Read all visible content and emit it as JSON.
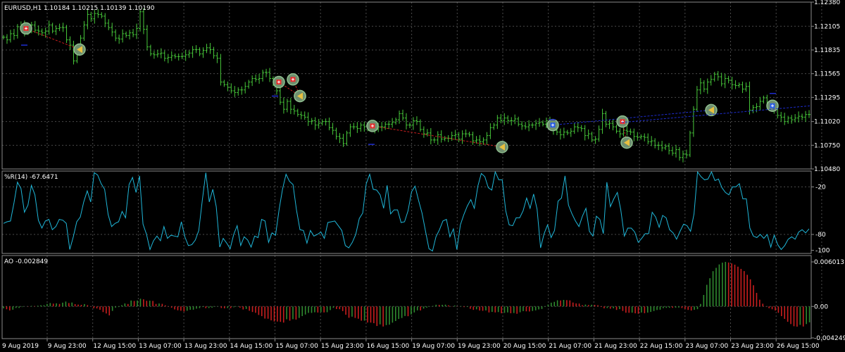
{
  "main_panel": {
    "title": "EURUSD,H1  1.10184 1.10215 1.10139 1.10190",
    "y_ticks": [
      "1.12380",
      "1.12105",
      "1.11835",
      "1.11565",
      "1.11295",
      "1.11020",
      "1.10750",
      "1.10480"
    ]
  },
  "wpr_panel": {
    "title": "%R(14) -67.6471",
    "y_ticks": [
      "-20",
      "-80",
      "-100"
    ]
  },
  "ao_panel": {
    "title": "AO -0.002849",
    "y_ticks": [
      "0.006013",
      "0.00",
      "-0.004249"
    ]
  },
  "x_ticks": [
    "9 Aug 2019",
    "9 Aug 23:00",
    "12 Aug 15:00",
    "13 Aug 07:00",
    "13 Aug 23:00",
    "14 Aug 15:00",
    "15 Aug 07:00",
    "15 Aug 23:00",
    "16 Aug 15:00",
    "19 Aug 07:00",
    "19 Aug 23:00",
    "20 Aug 15:00",
    "21 Aug 07:00",
    "21 Aug 23:00",
    "22 Aug 15:00",
    "23 Aug 07:00",
    "23 Aug 23:00",
    "26 Aug 15:00"
  ],
  "colors": {
    "background": "#000000",
    "grid": "#4a4a4a",
    "text": "#ffffff",
    "bar": "#47c83a",
    "wpr_line": "#1fb6d8",
    "ao_up": "#2f8a2f",
    "ao_down": "#c81e1e",
    "signal_line": "#1e2ccf",
    "trade_line": "#c81e1e",
    "marker_ring": "#8fbf8f"
  },
  "chart_data": [
    {
      "type": "ohlc",
      "name": "EURUSD,H1",
      "ylim": [
        1.1048,
        1.1238
      ],
      "close": [
        1.1198,
        1.1195,
        1.1202,
        1.12,
        1.121,
        1.1212,
        1.1203,
        1.1207,
        1.1212,
        1.1206,
        1.1205,
        1.1203,
        1.1205,
        1.1212,
        1.1205,
        1.1208,
        1.1209,
        1.1209,
        1.1195,
        1.1189,
        1.1171,
        1.1186,
        1.1197,
        1.1212,
        1.1224,
        1.1219,
        1.1225,
        1.1224,
        1.1222,
        1.1214,
        1.1209,
        1.1204,
        1.1197,
        1.1196,
        1.1202,
        1.12,
        1.1203,
        1.1201,
        1.1208,
        1.1227,
        1.1207,
        1.1187,
        1.1179,
        1.1178,
        1.1179,
        1.118,
        1.1174,
        1.1175,
        1.1177,
        1.1176,
        1.1176,
        1.1176,
        1.1178,
        1.118,
        1.1184,
        1.1184,
        1.1179,
        1.1183,
        1.1186,
        1.1184,
        1.1177,
        1.1174,
        1.1147,
        1.1144,
        1.1141,
        1.1137,
        1.1135,
        1.1138,
        1.1138,
        1.1142,
        1.1147,
        1.1151,
        1.115,
        1.1151,
        1.1158,
        1.1158,
        1.1151,
        1.1145,
        1.1137,
        1.1124,
        1.1116,
        1.1125,
        1.1116,
        1.1114,
        1.111,
        1.1109,
        1.1107,
        1.1102,
        1.1103,
        1.1098,
        1.11,
        1.1102,
        1.1102,
        1.1095,
        1.1092,
        1.1085,
        1.1083,
        1.1077,
        1.1089,
        1.1096,
        1.1096,
        1.1094,
        1.1098,
        1.1096,
        1.1095,
        1.1096,
        1.1093,
        1.1096,
        1.1096,
        1.1099,
        1.1099,
        1.1101,
        1.1104,
        1.1111,
        1.1106,
        1.1098,
        1.1098,
        1.1103,
        1.1102,
        1.1093,
        1.1088,
        1.1089,
        1.1081,
        1.1081,
        1.1087,
        1.1082,
        1.1083,
        1.1083,
        1.1086,
        1.1087,
        1.1082,
        1.1088,
        1.1088,
        1.1087,
        1.108,
        1.1081,
        1.1079,
        1.1081,
        1.1086,
        1.1095,
        1.1098,
        1.1106,
        1.1103,
        1.1106,
        1.1103,
        1.1103,
        1.1105,
        1.1099,
        1.1097,
        1.1096,
        1.1098,
        1.1098,
        1.11,
        1.1101,
        1.1099,
        1.1103,
        1.1099,
        1.1092,
        1.109,
        1.1087,
        1.109,
        1.1089,
        1.1091,
        1.1096,
        1.1095,
        1.1094,
        1.1086,
        1.1088,
        1.1081,
        1.1082,
        1.1093,
        1.1111,
        1.1099,
        1.11,
        1.1096,
        1.1091,
        1.1088,
        1.1092,
        1.1091,
        1.109,
        1.1085,
        1.1084,
        1.1085,
        1.1084,
        1.1079,
        1.108,
        1.1075,
        1.1075,
        1.1072,
        1.1074,
        1.1069,
        1.1066,
        1.107,
        1.1061,
        1.1065,
        1.1064,
        1.1089,
        1.1116,
        1.1138,
        1.1146,
        1.1139,
        1.1147,
        1.115,
        1.1156,
        1.1153,
        1.1145,
        1.1151,
        1.1149,
        1.1144,
        1.1143,
        1.1144,
        1.1139,
        1.1142,
        1.1115,
        1.1118,
        1.1119,
        1.1125,
        1.1129,
        1.1121,
        1.112,
        1.1116,
        1.1109,
        1.1107,
        1.1102,
        1.1106,
        1.1104,
        1.1106,
        1.1108,
        1.1107,
        1.111,
        1.111
      ]
    },
    {
      "type": "line",
      "name": "%R(14)",
      "ylim": [
        -104,
        0
      ],
      "values": [
        -66,
        -64,
        -63,
        -40,
        -14,
        -22,
        -52,
        -43,
        -18,
        -30,
        -62,
        -72,
        -63,
        -61,
        -74,
        -70,
        -61,
        -62,
        -66,
        -99,
        -83,
        -64,
        -58,
        -39,
        -25,
        -39,
        -2,
        -5,
        -16,
        -23,
        -55,
        -70,
        -66,
        -64,
        -51,
        -59,
        -17,
        -8,
        -27,
        -6,
        -67,
        -80,
        -99,
        -88,
        -82,
        -88,
        -70,
        -85,
        -81,
        -82,
        -83,
        -64,
        -83,
        -94,
        -93,
        -87,
        -75,
        -37,
        -2,
        -39,
        -23,
        -45,
        -96,
        -85,
        -91,
        -98,
        -80,
        -69,
        -94,
        -83,
        -87,
        -96,
        -82,
        -84,
        -61,
        -63,
        -90,
        -78,
        -81,
        -49,
        -23,
        -4,
        -13,
        -17,
        -49,
        -74,
        -75,
        -91,
        -75,
        -82,
        -80,
        -77,
        -85,
        -65,
        -64,
        -63,
        -69,
        -75,
        -94,
        -97,
        -90,
        -80,
        -60,
        -53,
        -16,
        -4,
        -23,
        -24,
        -30,
        -47,
        -18,
        -54,
        -49,
        -49,
        -65,
        -64,
        -50,
        -26,
        -19,
        -37,
        -53,
        -76,
        -98,
        -101,
        -83,
        -74,
        -63,
        -61,
        -83,
        -73,
        -99,
        -68,
        -55,
        -44,
        -36,
        -47,
        -19,
        -3,
        -7,
        -21,
        -24,
        -1,
        -11,
        -11,
        -50,
        -68,
        -69,
        -59,
        -59,
        -50,
        -34,
        -47,
        -29,
        -48,
        -97,
        -79,
        -68,
        -84,
        -75,
        -38,
        -34,
        -6,
        -43,
        -54,
        -63,
        -70,
        -57,
        -47,
        -76,
        -82,
        -57,
        -61,
        -79,
        -14,
        -45,
        -35,
        -27,
        -49,
        -82,
        -72,
        -72,
        -77,
        -90,
        -85,
        -79,
        -79,
        -52,
        -58,
        -71,
        -56,
        -59,
        -74,
        -78,
        -86,
        -76,
        -67,
        -69,
        -76,
        -54,
        -1,
        -7,
        -11,
        -10,
        -1,
        -12,
        -10,
        -21,
        -27,
        -30,
        -20,
        -20,
        -16,
        -35,
        -35,
        -72,
        -82,
        -84,
        -80,
        -85,
        -80,
        -96,
        -81,
        -93,
        -99,
        -94,
        -86,
        -83,
        -86,
        -77,
        -74,
        -78,
        -73
      ]
    },
    {
      "type": "bar",
      "name": "AO",
      "ylim": [
        -0.004249,
        0.006013
      ],
      "values": [
        -0.00026,
        -0.00038,
        -0.00054,
        -0.00044,
        -0.0002,
        -0.0002,
        -8e-05,
        1e-05,
        -3e-05,
        7e-05,
        5e-05,
        0.0001,
        0.00016,
        0.00016,
        0.00034,
        0.00046,
        0.00038,
        0.00042,
        0.00034,
        0.00051,
        0.00066,
        0.00046,
        0.00053,
        0.00031,
        0.00025,
        0.00022,
        0.00032,
        0.00018,
        -3e-05,
        -0.00024,
        -0.00027,
        -0.00045,
        -0.00076,
        -0.00095,
        -0.00121,
        -0.0006,
        -0.00016,
        -8e-05,
        0.00017,
        0.0004,
        0.00033,
        0.0008,
        0.00074,
        0.0008,
        0.00104,
        0.00096,
        0.00076,
        0.00078,
        0.00075,
        0.00034,
        0.0004,
        0.00035,
        0.00015,
        -4e-05,
        -0.00017,
        -0.0004,
        -0.00052,
        -0.00058,
        -0.00069,
        -0.00058,
        -0.00045,
        -0.00044,
        -0.0003,
        -0.00022,
        -8e-05,
        -0.00023,
        -0.00021,
        -0.00017,
        -5e-05,
        -2e-05,
        -0.00021,
        -0.00026,
        -0.00021,
        -0.00023,
        -0.00011,
        -4e-05,
        -0.00016,
        -0.00041,
        -0.00034,
        -0.00058,
        -0.00075,
        -0.00086,
        -0.00115,
        -0.00131,
        -0.00164,
        -0.00166,
        -0.00188,
        -0.00203,
        -0.00204,
        -0.00208,
        -0.00218,
        -0.00173,
        -0.00192,
        -0.00172,
        -0.00178,
        -0.00155,
        -0.0013,
        -0.00109,
        -0.00087,
        -0.00087,
        -0.00079,
        -0.00082,
        -0.00077,
        -0.00081,
        -0.00078,
        -0.00049,
        -0.00019,
        -0.00035,
        -0.00037,
        -0.00063,
        -0.00112,
        -0.00153,
        -0.00138,
        -0.00155,
        -0.00166,
        -0.00192,
        -0.00192,
        -0.00217,
        -0.00218,
        -0.00226,
        -0.00264,
        -0.00242,
        -0.00271,
        -0.00252,
        -0.00246,
        -0.00219,
        -0.00197,
        -0.00169,
        -0.00156,
        -0.00129,
        -0.00132,
        -0.00108,
        -0.00081,
        -0.00053,
        -0.00054,
        -0.00029,
        -0.00016,
        -4e-05,
        7e-05,
        0.00023,
        0.00021,
        0.00022,
        0.00024,
        0.00015,
        3e-05,
        0.00012,
        3e-05,
        5e-05,
        -9e-05,
        -7e-05,
        -0.00032,
        -0.00046,
        -0.00039,
        -0.00055,
        -0.00059,
        -0.00054,
        -0.00081,
        -0.00074,
        -0.00081,
        -0.00076,
        -0.00092,
        -0.00087,
        -0.00081,
        -0.00092,
        -0.00089,
        -0.00099,
        -0.00079,
        -0.00063,
        -0.00066,
        -0.00068,
        -0.00061,
        -0.00053,
        -0.0004,
        -0.00034,
        -6e-05,
        0.00026,
        0.00051,
        0.00062,
        0.00083,
        0.00081,
        0.00088,
        0.00085,
        0.00082,
        0.00053,
        0.00041,
        0.00039,
        0.00017,
        0.00025,
        0.00019,
        0.00023,
        0.0002,
        0.00017,
        -7e-05,
        -0.00026,
        -0.00021,
        -0.00031,
        -0.00025,
        -0.00047,
        -0.00036,
        -0.00061,
        -0.00085,
        -0.00086,
        -0.00084,
        -0.00093,
        -0.00099,
        -0.00082,
        -0.00091,
        -0.00083,
        -0.00074,
        -0.00062,
        -0.00048,
        -0.00044,
        -0.00023,
        -0.00019,
        -0.00018,
        -0.00019,
        -0.00016,
        -0.00015,
        -0.00021,
        -0.00034,
        -0.00047,
        -0.00055,
        -0.00045,
        -0.00037,
        0.00034,
        0.00155,
        0.00292,
        0.00381,
        0.00476,
        0.00521,
        0.00567,
        0.00591,
        0.00601,
        0.00593,
        0.00581,
        0.00564,
        0.00537,
        0.00507,
        0.00477,
        0.00427,
        0.00366,
        0.00286,
        0.00183,
        0.00091,
        0.00037,
        -4e-05,
        -0.00024,
        -0.00038,
        -0.00055,
        -0.00086,
        -0.00131,
        -0.00168,
        -0.00207,
        -0.00238,
        -0.00267,
        -0.00273,
        -0.00249,
        -0.00271,
        -0.00238,
        -0.00215
      ]
    }
  ],
  "trades": [
    {
      "entry": {
        "x": 37,
        "y": 1.1208,
        "kind": "sell"
      },
      "exit": {
        "x": 113,
        "y": 1.1184
      }
    },
    {
      "entry": {
        "x": 396,
        "y": 1.1147,
        "kind": "sell"
      },
      "exit": {
        "x": 426,
        "y": 1.1131
      }
    },
    {
      "entry": {
        "x": 416,
        "y": 1.115,
        "kind": "sell"
      },
      "exit": {
        "x": 426,
        "y": 1.1131
      }
    },
    {
      "entry": {
        "x": 529,
        "y": 1.1097,
        "kind": "sell"
      },
      "exit": {
        "x": 713,
        "y": 1.1073
      }
    },
    {
      "entry": {
        "x": 884,
        "y": 1.1102,
        "kind": "sell"
      },
      "exit": {
        "x": 890,
        "y": 1.1078
      }
    },
    {
      "entry": {
        "x": 785,
        "y": 1.1098,
        "kind": "buy"
      },
      "exit": {
        "x": 1010,
        "y": 1.1115
      }
    },
    {
      "entry": {
        "x": 1097,
        "y": 1.112,
        "kind": "buy"
      },
      "exit": null
    }
  ]
}
